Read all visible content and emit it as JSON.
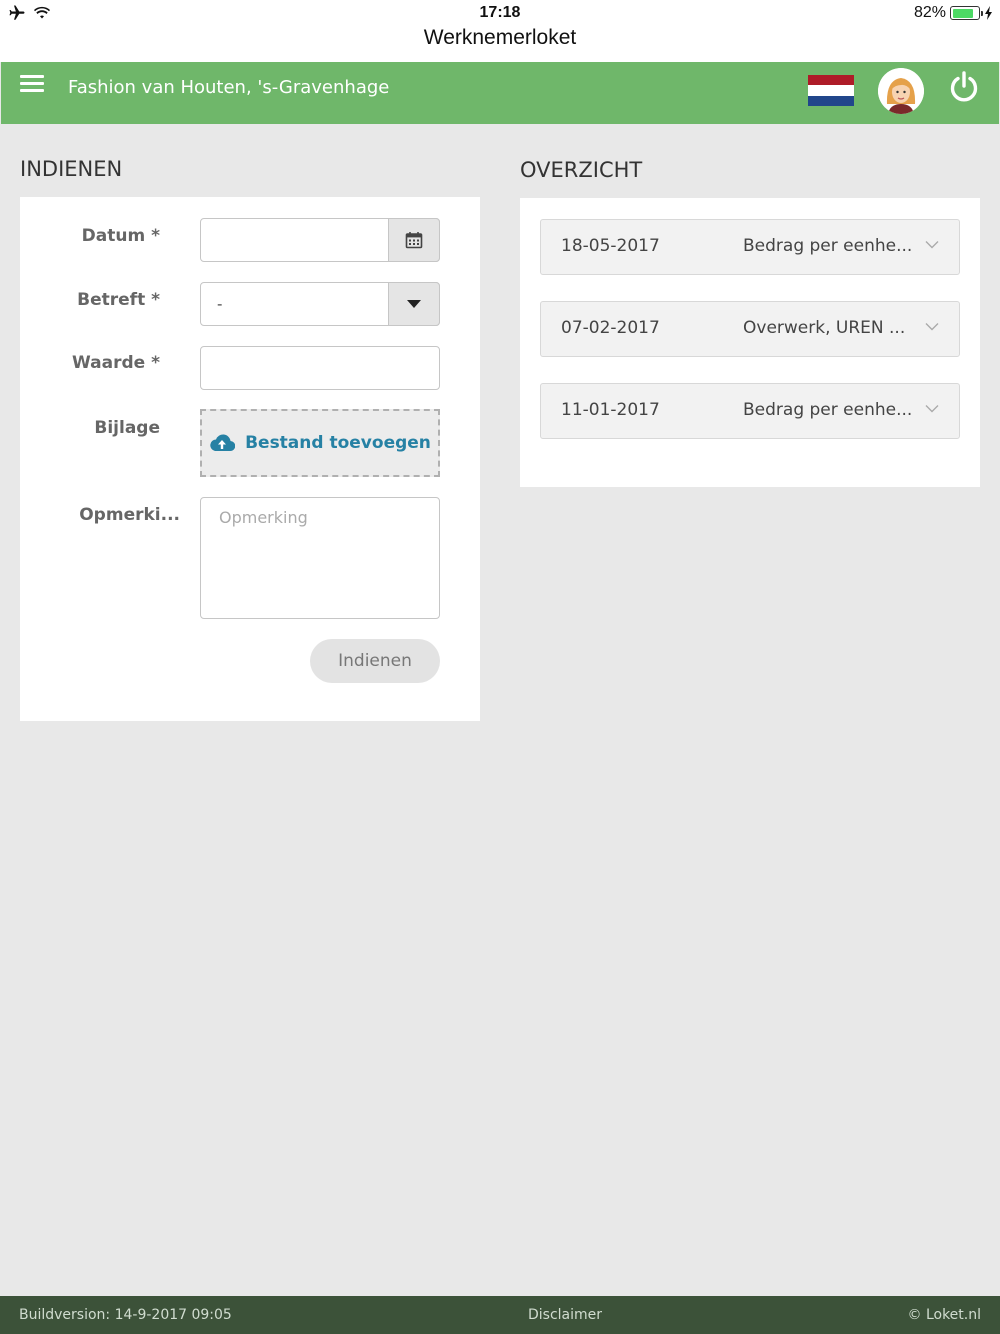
{
  "status_bar": {
    "time": "17:18",
    "title": "Werknemerloket",
    "battery": "82%",
    "battery_level": 0.82
  },
  "header": {
    "company": "Fashion van Houten, 's-Gravenhage",
    "icons": [
      "menu-icon",
      "dutch-flag-icon",
      "avatar-icon",
      "power-icon"
    ],
    "accent_color": "#6fb76a"
  },
  "indienen": {
    "heading": "INDIENEN",
    "fields": {
      "datum_label": "Datum *",
      "datum_value": "",
      "betreft_label": "Betreft *",
      "betreft_selected": "-",
      "waarde_label": "Waarde *",
      "waarde_value": "",
      "bijlage_label": "Bijlage",
      "bijlage_button": "Bestand toevoegen",
      "opmerking_label": "Opmerki...",
      "opmerking_placeholder": "Opmerking"
    },
    "submit_label": "Indienen"
  },
  "overzicht": {
    "heading": "OVERZICHT",
    "items": [
      {
        "date": "18-05-2017",
        "description": "Bedrag per eenhe..."
      },
      {
        "date": "07-02-2017",
        "description": "Overwerk, UREN ..."
      },
      {
        "date": "11-01-2017",
        "description": "Bedrag per eenhe..."
      }
    ]
  },
  "footer": {
    "build": "Buildversion: 14-9-2017 09:05",
    "disclaimer": "Disclaimer",
    "copyright": "© Loket.nl"
  }
}
